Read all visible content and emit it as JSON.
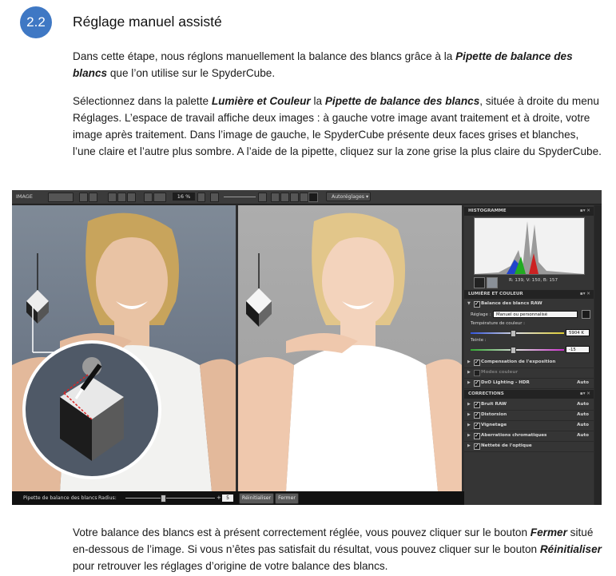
{
  "section": {
    "number": "2.2",
    "title": "Réglage manuel assisté"
  },
  "paragraph1": {
    "t1": "Dans cette étape, nous réglons manuellement la balance des blancs grâce à la ",
    "b1": "Pipette de balance des blancs",
    "t2": " que l’on utilise sur le SpyderCube."
  },
  "paragraph2": {
    "t1": "Sélectionnez dans la palette ",
    "b1": "Lumière et Couleur",
    "t2": " la ",
    "b2": "Pipette de balance des blancs",
    "t3": ", située à droite du menu Réglages. L’espace de travail affiche deux images : à gauche votre image avant traitement et à droite, votre image après traitement. Dans l’image de gauche, le SpyderCube présente deux faces grises et blanches, l’une claire et l’autre plus sombre. A l’aide de la pipette, cliquez sur la zone grise la plus claire du SpyderCube."
  },
  "paragraph3": {
    "t1": "Votre balance des blancs est à présent correctement réglée, vous pouvez cliquer sur le bouton ",
    "b1": "Fermer",
    "t2": " situé en-dessous de l’image. Si vous n’êtes pas satisfait du résultat, vous pouvez cliquer sur le bouton ",
    "b2": "Réinitialiser",
    "t3": " pour retrouver les réglages d’origine de votre balance des blancs."
  },
  "app": {
    "toolbar": {
      "label": "IMAGE",
      "zoom": "16 %",
      "autoreglages": "Autoréglages"
    },
    "histogram": {
      "title": "HISTOGRAMME",
      "rgb_readout": "R: 139, V: 150, B: 157"
    },
    "lumiere": {
      "title": "LUMIÈRE ET COULEUR",
      "wb_raw": "Balance des blancs RAW",
      "reglage_label": "Réglage :",
      "reglage_value": "Manuel ou personnalisé",
      "temp_label": "Température de couleur :",
      "temp_value": "5904 K",
      "teinte_label": "Teinte :",
      "teinte_value": "-15",
      "exposure": "Compensation de l'exposition",
      "color_modes": "Modes couleur",
      "dxo_hdr": "DxO Lighting - HDR",
      "dxo_hdr_value": "Auto"
    },
    "corrections": {
      "title": "CORRECTIONS",
      "items": [
        {
          "label": "Bruit RAW",
          "value": "Auto"
        },
        {
          "label": "Distorsion",
          "value": "Auto"
        },
        {
          "label": "Vignetage",
          "value": "Auto"
        },
        {
          "label": "Aberrations chromatiques",
          "value": "Auto"
        },
        {
          "label": "Netteté de l'optique",
          "value": ""
        }
      ]
    },
    "bottom": {
      "tool_label": "Pipette de balance des blancs",
      "radius_label": "Radius:",
      "radius_value": "5",
      "reset_button": "Réinitialiser",
      "close_button": "Fermer"
    }
  }
}
